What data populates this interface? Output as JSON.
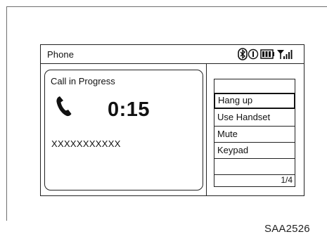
{
  "screen": {
    "title": "Phone",
    "status_icons": [
      "bluetooth-icon",
      "info-icon",
      "battery-icon",
      "signal-icon"
    ]
  },
  "call": {
    "status_text": "Call in Progress",
    "duration": "0:15",
    "number": "XXXXXXXXXXX"
  },
  "menu": {
    "items": [
      {
        "label": "",
        "selected": false
      },
      {
        "label": "Hang up",
        "selected": true
      },
      {
        "label": "Use Handset",
        "selected": false
      },
      {
        "label": "Mute",
        "selected": false
      },
      {
        "label": "Keypad",
        "selected": false
      },
      {
        "label": "",
        "selected": false
      }
    ],
    "page_indicator": "1/4"
  },
  "figure_code": "SAA2526"
}
